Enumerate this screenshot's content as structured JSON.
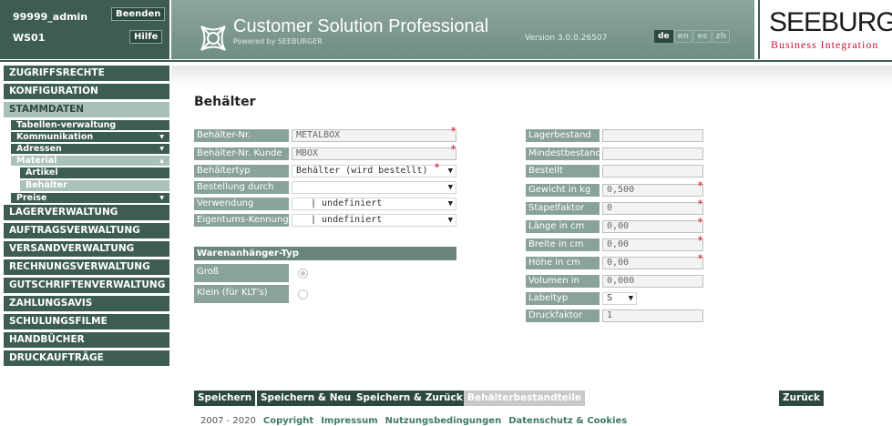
{
  "user": {
    "name": "99999_admin",
    "workstation": "WS01",
    "quit_label": "Beenden",
    "help_label": "Hilfe"
  },
  "app": {
    "title": "Customer Solution Professional",
    "subtitle": "Powered by SEEBURGER",
    "version": "Version 3.0.0.26507"
  },
  "languages": [
    {
      "code": "de",
      "active": true
    },
    {
      "code": "en"
    },
    {
      "code": "es"
    },
    {
      "code": "zh"
    }
  ],
  "brand": {
    "name": "SEEBURGER",
    "tagline": "Business Integration"
  },
  "nav": {
    "main1": [
      "ZUGRIFFSRECHTE",
      "KONFIGURATION",
      "STAMMDATEN"
    ],
    "sub": [
      {
        "label": "Tabellen-verwaltung",
        "chev": ""
      },
      {
        "label": "Kommunikation",
        "chev": "▾"
      },
      {
        "label": "Adressen",
        "chev": "▾"
      },
      {
        "label": "Material",
        "chev": "▴"
      }
    ],
    "material_items": [
      "Artikel",
      "Behälter"
    ],
    "preise": {
      "label": "Preise",
      "chev": "▾"
    },
    "main2": [
      "LAGERVERWALTUNG",
      "AUFTRAGSVERWALTUNG",
      "VERSANDVERWALTUNG",
      "RECHNUNGSVERWALTUNG",
      "GUTSCHRIFTENVERWALTUNG",
      "ZAHLUNGSAVIS",
      "SCHULUNGSFILME",
      "HANDBÜCHER",
      "DRUCKAUFTRÄGE"
    ]
  },
  "page": {
    "title": "Behälter"
  },
  "form_left": [
    {
      "label": "Behälter-Nr.",
      "value": "METALBOX",
      "required": true
    },
    {
      "label": "Behälter-Nr. Kunde",
      "value": "MBOX",
      "required": true
    },
    {
      "label": "Behältertyp",
      "value": "Behälter (wird bestellt)",
      "required": true,
      "select": true
    },
    {
      "label": "Bestellung durch",
      "value": "",
      "select": true
    },
    {
      "label": "Verwendung",
      "value": "| undefiniert",
      "select": true
    },
    {
      "label": "Eigentums-Kennung",
      "value": "| undefiniert",
      "select": true
    }
  ],
  "tag_section": {
    "title": "Warenanhänger-Typ",
    "options": [
      {
        "label": "Groß",
        "selected": true
      },
      {
        "label": "Klein (für KLT's)",
        "selected": false
      }
    ]
  },
  "form_right": [
    {
      "label": "Lagerbestand",
      "value": ""
    },
    {
      "label": "Mindestbestand",
      "value": ""
    },
    {
      "label": "Bestellt",
      "value": ""
    },
    {
      "label": "Gewicht in kg",
      "value": "0,500",
      "required": true
    },
    {
      "label": "Stapelfaktor",
      "value": "0",
      "required": true
    },
    {
      "label": "Länge in cm",
      "value": "0,00",
      "required": true
    },
    {
      "label": "Breite in cm",
      "value": "0,00",
      "required": true
    },
    {
      "label": "Höhe in cm",
      "value": "0,00",
      "required": true
    },
    {
      "label": "Volumen in ccm",
      "value": "0,000"
    },
    {
      "label": "Labeltyp",
      "value": "S",
      "select": true
    },
    {
      "label": "Druckfaktor",
      "value": "1"
    }
  ],
  "actions": {
    "save": "Speichern",
    "save_new": "Speichern & Neu",
    "save_back": "Speichern & Zurück",
    "components": "Behälterbestandteile",
    "back": "Zurück"
  },
  "footer": {
    "years": "2007 - 2020",
    "links": [
      "Copyright",
      "Impressum",
      "Nutzungsbedingungen",
      "Datenschutz & Cookies"
    ]
  },
  "colors": {
    "primary": "#3d5c52",
    "active": "#a9c1b7",
    "label": "#8aa399",
    "required": "#d41f2c"
  }
}
